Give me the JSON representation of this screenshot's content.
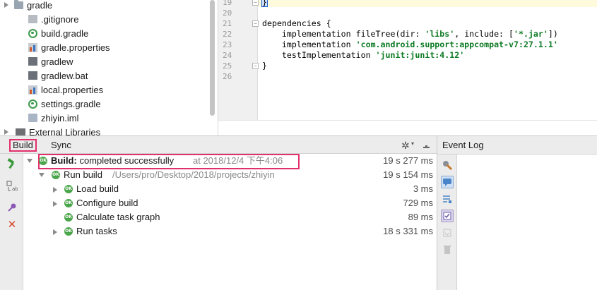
{
  "project_tree": {
    "items": [
      {
        "label": "gradle",
        "icon": "folder-icon"
      },
      {
        "label": ".gitignore",
        "icon": "text-file-icon"
      },
      {
        "label": "build.gradle",
        "icon": "gradle-icon"
      },
      {
        "label": "gradle.properties",
        "icon": "properties-file-icon"
      },
      {
        "label": "gradlew",
        "icon": "script-file-icon"
      },
      {
        "label": "gradlew.bat",
        "icon": "script-file-icon"
      },
      {
        "label": "local.properties",
        "icon": "properties-file-icon"
      },
      {
        "label": "settings.gradle",
        "icon": "gradle-icon"
      },
      {
        "label": "zhiyin.iml",
        "icon": "module-file-icon"
      },
      {
        "label": "External Libraries",
        "icon": "libraries-icon"
      }
    ]
  },
  "editor": {
    "line_numbers": [
      "19",
      "20",
      "21",
      "22",
      "23",
      "24",
      "25",
      "26"
    ],
    "lines": {
      "l19": "}",
      "l21": "dependencies {",
      "l22_a": "    implementation fileTree(dir: ",
      "l22_b": "'libs'",
      "l22_c": ", include: [",
      "l22_d": "'*.jar'",
      "l22_e": "])",
      "l23_a": "    implementation ",
      "l23_b": "'com.android.support:appcompat-v7:27.1.1'",
      "l24_a": "    testImplementation ",
      "l24_b": "'junit:junit:4.12'",
      "l25": "}"
    }
  },
  "build_window": {
    "tabs": {
      "build": "Build",
      "sync": "Sync"
    },
    "rows": [
      {
        "label_bold": "Build:",
        "label": " completed successfully",
        "extra": "at 2018/12/4 下午4:06",
        "time": "19 s 277 ms"
      },
      {
        "label": "Run build",
        "extra": "/Users/pro/Desktop/2018/projects/zhiyin",
        "time": "19 s 154 ms"
      },
      {
        "label": "Load build",
        "time": "3 ms"
      },
      {
        "label": "Configure build",
        "time": "729 ms"
      },
      {
        "label": "Calculate task graph",
        "time": "89 ms"
      },
      {
        "label": "Run tasks",
        "time": "18 s 331 ms"
      }
    ],
    "ok_badge": "OK"
  },
  "event_log": {
    "title": "Event Log"
  },
  "colors": {
    "highlight_border": "#e2306c",
    "ok_green": "#4ba54b",
    "string_green": "#0d7a24"
  }
}
